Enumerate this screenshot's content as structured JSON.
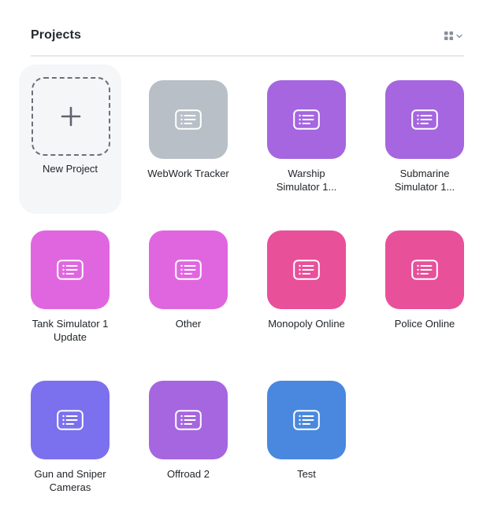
{
  "header": {
    "title": "Projects"
  },
  "new_project": {
    "label": "New Project"
  },
  "projects": [
    {
      "name": "WebWork Tracker",
      "color": "#b8bfc7"
    },
    {
      "name": "Warship Simulator 1...",
      "color": "#a566e0"
    },
    {
      "name": "Submarine Simulator 1...",
      "color": "#a566e0"
    },
    {
      "name": "Tank Simulator 1 Update",
      "color": "#e066e0"
    },
    {
      "name": "Other",
      "color": "#e066e0"
    },
    {
      "name": "Monopoly Online",
      "color": "#e8509a"
    },
    {
      "name": "Police Online",
      "color": "#e8509a"
    },
    {
      "name": "Gun and Sniper Cameras",
      "color": "#7b70ee"
    },
    {
      "name": "Offroad 2",
      "color": "#a566e0"
    },
    {
      "name": "Test",
      "color": "#4a88df"
    }
  ],
  "icons": {
    "view_toggle": "grid-icon",
    "view_dropdown": "chevron-down-icon",
    "add": "plus-icon",
    "project": "list-icon"
  }
}
